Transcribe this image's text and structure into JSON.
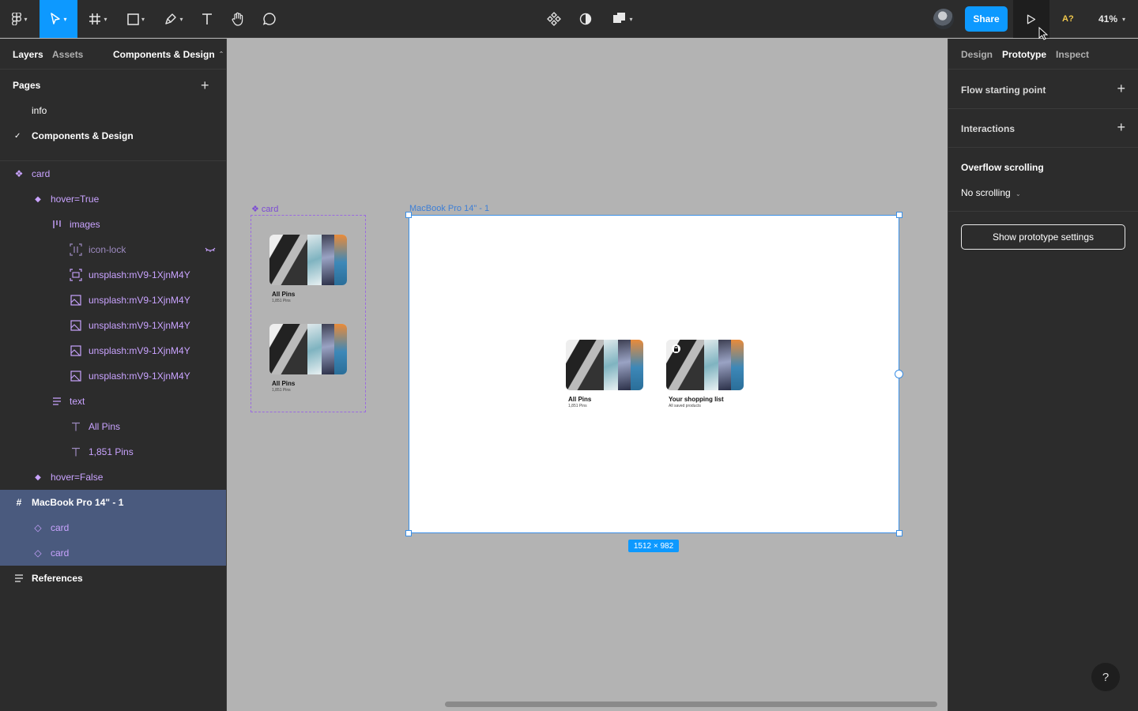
{
  "toolbar": {
    "share_label": "Share",
    "access_label": "A?",
    "zoom_label": "41%"
  },
  "left_panel": {
    "tabs": {
      "layers": "Layers",
      "assets": "Assets",
      "page_switch": "Components & Design"
    },
    "pages_title": "Pages",
    "pages": [
      {
        "label": "info",
        "current": false
      },
      {
        "label": "Components & Design",
        "current": true
      }
    ],
    "layers": [
      {
        "label": "card",
        "icon": "component-set-icon"
      },
      {
        "label": "hover=True",
        "icon": "variant-icon"
      },
      {
        "label": "images",
        "icon": "auto-layout-icon"
      },
      {
        "label": "icon-lock",
        "icon": "hidden-frame-icon",
        "hidden": true
      },
      {
        "label": "unsplash:mV9-1XjnM4Y",
        "icon": "frame-image-icon"
      },
      {
        "label": "unsplash:mV9-1XjnM4Y",
        "icon": "image-icon"
      },
      {
        "label": "unsplash:mV9-1XjnM4Y",
        "icon": "image-icon"
      },
      {
        "label": "unsplash:mV9-1XjnM4Y",
        "icon": "image-icon"
      },
      {
        "label": "unsplash:mV9-1XjnM4Y",
        "icon": "image-icon"
      },
      {
        "label": "text",
        "icon": "text-stack-icon"
      },
      {
        "label": "All Pins",
        "icon": "text-icon"
      },
      {
        "label": "1,851 Pins",
        "icon": "text-icon"
      },
      {
        "label": "hover=False",
        "icon": "variant-icon"
      },
      {
        "label": "MacBook Pro 14\" - 1",
        "icon": "frame-icon"
      },
      {
        "label": "card",
        "icon": "instance-icon"
      },
      {
        "label": "card",
        "icon": "instance-icon"
      },
      {
        "label": "References",
        "icon": "list-icon"
      }
    ]
  },
  "right_panel": {
    "tabs": {
      "design": "Design",
      "prototype": "Prototype",
      "inspect": "Inspect"
    },
    "flow_start": "Flow starting point",
    "interactions": "Interactions",
    "overflow_title": "Overflow scrolling",
    "overflow_value": "No scrolling",
    "proto_settings_btn": "Show prototype settings",
    "help": "?"
  },
  "canvas": {
    "component_label": "card",
    "frame_label": "MacBook Pro 14\" - 1",
    "frame_dims": "1512 × 982",
    "component_cards": [
      {
        "title": "All Pins",
        "subtitle": "1,851 Pins"
      },
      {
        "title": "All Pins",
        "subtitle": "1,851 Pins"
      }
    ],
    "frame_cards": [
      {
        "title": "All Pins",
        "subtitle": "1,851 Pins"
      },
      {
        "title": "Your shopping list",
        "subtitle": "All saved products"
      }
    ]
  },
  "colors": {
    "accent": "#0d99ff",
    "component_purple": "#c9a3ff",
    "selection": "#4a5a7e"
  }
}
